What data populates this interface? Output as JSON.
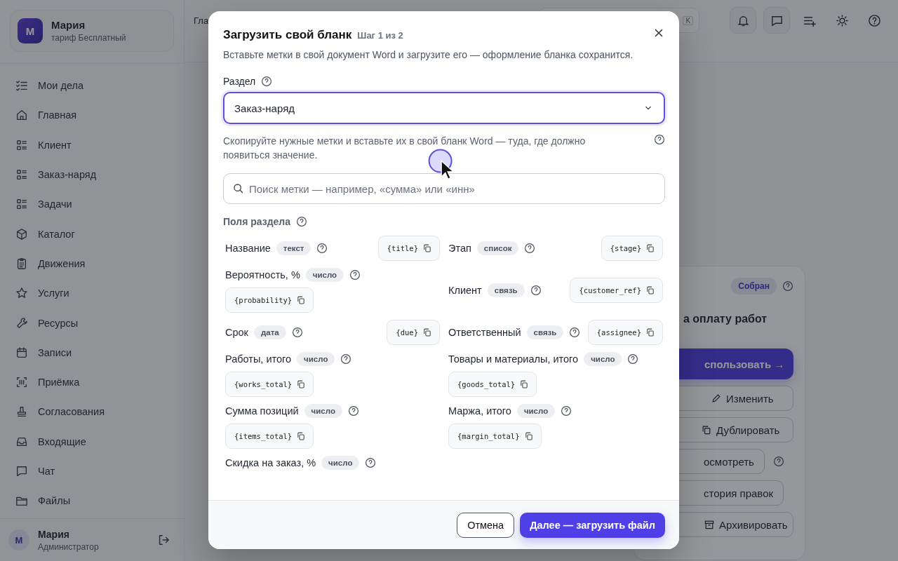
{
  "profile": {
    "avatar": "М",
    "name": "Мария",
    "plan": "тариф Бесплатный"
  },
  "sidebar": {
    "items": [
      {
        "label": "Мои дела"
      },
      {
        "label": "Главная"
      },
      {
        "label": "Клиент"
      },
      {
        "label": "Заказ-наряд"
      },
      {
        "label": "Задачи"
      },
      {
        "label": "Каталог"
      },
      {
        "label": "Движения"
      },
      {
        "label": "Услуги"
      },
      {
        "label": "Ресурсы"
      },
      {
        "label": "Записи"
      },
      {
        "label": "Приёмка"
      },
      {
        "label": "Согласования"
      },
      {
        "label": "Входящие"
      },
      {
        "label": "Чат"
      },
      {
        "label": "Файлы"
      }
    ]
  },
  "user": {
    "avatar": "М",
    "name": "Мария",
    "role": "Администратор"
  },
  "topbar": {
    "breadcrumb": "Гла",
    "shortcut": "K"
  },
  "background_card": {
    "status": "Собран",
    "title": "а оплату работ",
    "primary": "спользовать →",
    "actions": [
      {
        "label": "Изменить",
        "kind": "edit"
      },
      {
        "label": "Дублировать",
        "kind": "copy"
      },
      {
        "label": "осмотреть",
        "kind": "help"
      },
      {
        "label": "стория правок",
        "kind": "plain"
      },
      {
        "label": "Архивировать",
        "kind": "archive"
      }
    ]
  },
  "dialog": {
    "title": "Загрузить свой бланк",
    "step": "Шаг 1 из 2",
    "subtitle": "Вставьте метки в свой документ Word и загрузите его — оформление бланка сохранится.",
    "section_label": "Раздел",
    "section_value": "Заказ-наряд",
    "hint": "Скопируйте нужные метки и вставьте их в свой бланк Word — туда, где должно появиться значение.",
    "search": {
      "placeholder": "Поиск метки — например, «сумма» или «инн»"
    },
    "fields_title": "Поля раздела",
    "fields": [
      {
        "label": "Название",
        "type": "текст",
        "tag": "{title}"
      },
      {
        "label": "Этап",
        "type": "список",
        "tag": "{stage}"
      },
      {
        "label": "Вероятность, %",
        "type": "число",
        "tag": "{probability}"
      },
      {
        "label": "Клиент",
        "type": "связь",
        "tag": "{customer_ref}"
      },
      {
        "label": "Срок",
        "type": "дата",
        "tag": "{due}"
      },
      {
        "label": "Ответственный",
        "type": "связь",
        "tag": "{assignee}"
      },
      {
        "label": "Работы, итого",
        "type": "число",
        "tag": "{works_total}"
      },
      {
        "label": "Товары и материалы, итого",
        "type": "число",
        "tag": "{goods_total}"
      },
      {
        "label": "Сумма позиций",
        "type": "число",
        "tag": "{items_total}"
      },
      {
        "label": "Маржа, итого",
        "type": "число",
        "tag": "{margin_total}"
      },
      {
        "label": "Скидка на заказ, %",
        "type": "число"
      }
    ],
    "buttons": {
      "cancel": "Отмена",
      "next": "Далее — загрузить файл"
    }
  }
}
